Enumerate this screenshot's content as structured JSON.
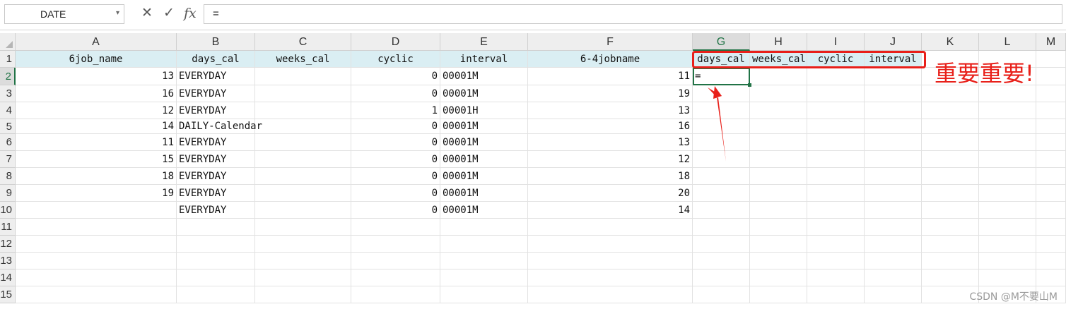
{
  "formula_bar": {
    "name_box": "DATE",
    "cancel_icon": "✕",
    "enter_icon": "✓",
    "fx_label": "fx",
    "formula": "="
  },
  "columns": [
    "A",
    "B",
    "C",
    "D",
    "E",
    "F",
    "G",
    "H",
    "I",
    "J",
    "K",
    "L",
    "M"
  ],
  "selected_column": "G",
  "row_numbers": [
    "1",
    "2",
    "3",
    "4",
    "5",
    "6",
    "7",
    "8",
    "9",
    "10",
    "11",
    "12",
    "13",
    "14",
    "15"
  ],
  "selected_row": "2",
  "header_row": {
    "A": "6job_name",
    "B": "days_cal",
    "C": "weeks_cal",
    "D": "cyclic",
    "E": "interval",
    "F": "6-4jobname",
    "G": "days_cal",
    "H": "weeks_cal",
    "I": "cyclic",
    "J": "interval"
  },
  "rows": [
    {
      "A": "13",
      "B": "EVERYDAY",
      "D": "0",
      "E": "00001M",
      "F": "11",
      "G": "="
    },
    {
      "A": "16",
      "B": "EVERYDAY",
      "D": "0",
      "E": "00001M",
      "F": "19"
    },
    {
      "A": "12",
      "B": "EVERYDAY",
      "D": "1",
      "E": "00001H",
      "F": "13"
    },
    {
      "A": "14",
      "B": "DAILY-Calendar",
      "D": "0",
      "E": "00001M",
      "F": "16"
    },
    {
      "A": "11",
      "B": "EVERYDAY",
      "D": "0",
      "E": "00001M",
      "F": "13"
    },
    {
      "A": "15",
      "B": "EVERYDAY",
      "D": "0",
      "E": "00001M",
      "F": "12"
    },
    {
      "A": "18",
      "B": "EVERYDAY",
      "D": "0",
      "E": "00001M",
      "F": "18"
    },
    {
      "A": "19",
      "B": "EVERYDAY",
      "D": "0",
      "E": "00001M",
      "F": "20"
    },
    {
      "A": "",
      "B": "EVERYDAY",
      "D": "0",
      "E": "00001M",
      "F": "14"
    }
  ],
  "annotation": {
    "text": "重要重要!",
    "color": "#e8201a"
  },
  "watermark": "CSDN @M不要山M",
  "colors": {
    "header_fill": "#daeef3",
    "selection": "#217346"
  }
}
